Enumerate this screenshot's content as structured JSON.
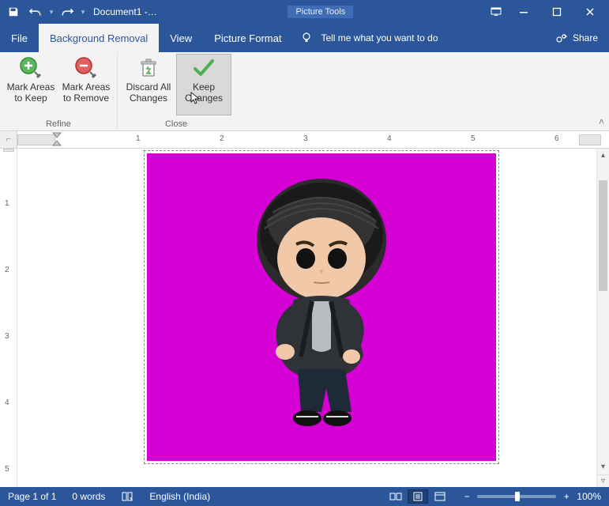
{
  "titlebar": {
    "doc_title": "Document1  -…",
    "contextual_label": "Picture Tools"
  },
  "tabs": {
    "file": "File",
    "bg_removal": "Background Removal",
    "view": "View",
    "picture_format": "Picture Format",
    "tellme": "Tell me what you want to do",
    "share": "Share"
  },
  "ribbon": {
    "refine_group": "Refine",
    "close_group": "Close",
    "mark_keep_l1": "Mark Areas",
    "mark_keep_l2": "to Keep",
    "mark_remove_l1": "Mark Areas",
    "mark_remove_l2": "to Remove",
    "discard_l1": "Discard All",
    "discard_l2": "Changes",
    "keep_l1": "Keep",
    "keep_l2": "Changes"
  },
  "ruler": {
    "numbers": [
      "1",
      "2",
      "3",
      "4",
      "5",
      "6"
    ]
  },
  "vruler": {
    "numbers": [
      "1",
      "2",
      "3",
      "4",
      "5"
    ]
  },
  "status": {
    "page": "Page 1 of 1",
    "words": "0 words",
    "language": "English (India)",
    "zoom": "100%"
  },
  "icons": {
    "save": "save-icon",
    "undo": "undo-icon",
    "redo": "redo-icon",
    "ribbon_display": "ribbon-display-icon",
    "minimize": "minimize-icon",
    "maximize": "maximize-icon",
    "close": "close-icon",
    "lamp": "lightbulb-icon",
    "share": "share-icon",
    "plus": "plus-circle-icon",
    "minus": "minus-circle-icon",
    "recycle": "recycle-icon",
    "check": "check-icon",
    "book": "book-icon",
    "read_mode": "read-mode-icon",
    "print_layout": "print-layout-icon",
    "web_layout": "web-layout-icon"
  }
}
